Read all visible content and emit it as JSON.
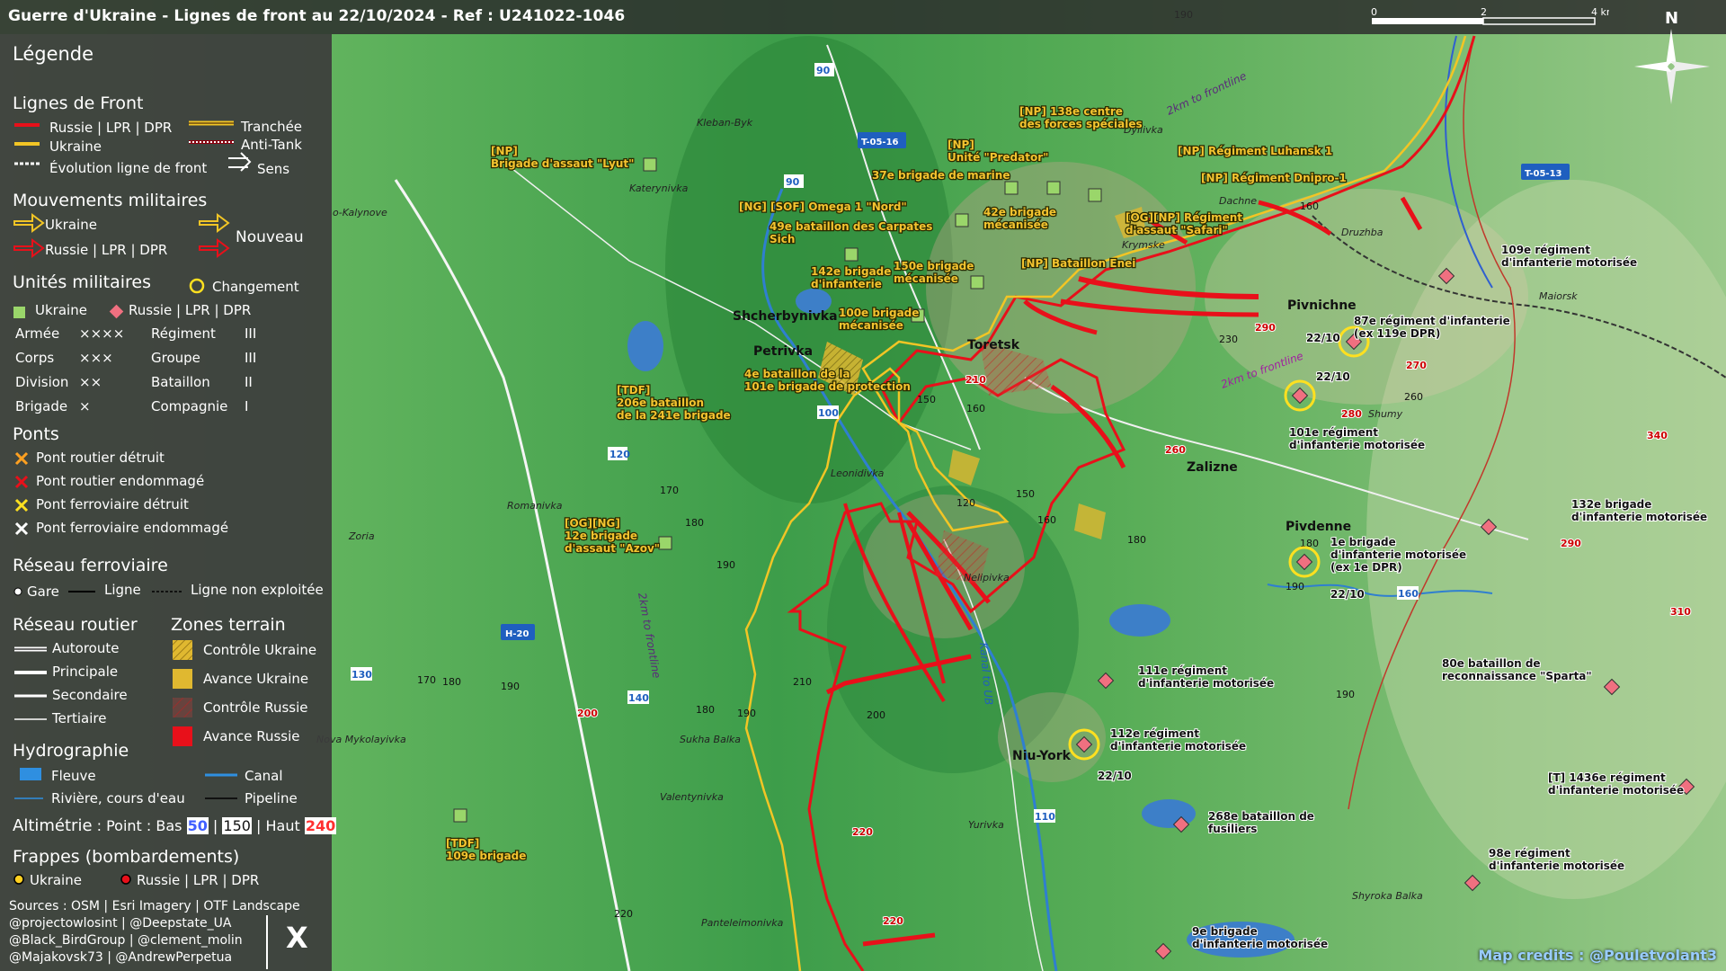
{
  "title": "Guerre d'Ukraine - Lignes de front au 22/10/2024 - Ref : U241022-1046",
  "scale": {
    "ticks": [
      "0",
      "2",
      "4 km"
    ]
  },
  "north": "N",
  "legend": {
    "heading": "Légende",
    "front": {
      "heading": "Lignes de Front",
      "russia": "Russie | LPR | DPR",
      "ukraine": "Ukraine",
      "evolution": "Évolution ligne de front",
      "trench": "Tranchée",
      "antitank": "Anti-Tank",
      "direction": "Sens"
    },
    "movements": {
      "heading": "Mouvements militaires",
      "ukraine": "Ukraine",
      "russia": "Russie | LPR | DPR",
      "new": "Nouveau"
    },
    "units": {
      "heading": "Unités militaires",
      "change": "Changement",
      "ukraine": "Ukraine",
      "russia": "Russie | LPR | DPR",
      "rows": [
        {
          "a": "Armée",
          "as": "××××",
          "b": "Régiment",
          "bs": "III"
        },
        {
          "a": "Corps",
          "as": "×××",
          "b": "Groupe",
          "bs": "III"
        },
        {
          "a": "Division",
          "as": "××",
          "b": "Bataillon",
          "bs": "II"
        },
        {
          "a": "Brigade",
          "as": "×",
          "b": "Compagnie",
          "bs": "I"
        }
      ]
    },
    "bridges": {
      "heading": "Ponts",
      "items": [
        "Pont routier détruit",
        "Pont routier endommagé",
        "Pont ferroviaire détruit",
        "Pont ferroviaire endommagé"
      ]
    },
    "rail": {
      "heading": "Réseau ferroviaire",
      "station": "Gare",
      "line": "Ligne",
      "unused": "Ligne non exploitée"
    },
    "roads": {
      "heading": "Réseau routier",
      "items": [
        "Autoroute",
        "Principale",
        "Secondaire",
        "Tertiaire"
      ]
    },
    "terrain": {
      "heading": "Zones terrain",
      "items": [
        "Contrôle Ukraine",
        "Avance Ukraine",
        "Contrôle Russie",
        "Avance Russie"
      ]
    },
    "hydro": {
      "heading": "Hydrographie",
      "river": "Fleuve",
      "canal": "Canal",
      "stream": "Rivière, cours d'eau",
      "pipeline": "Pipeline"
    },
    "altimetry": {
      "label": "Altimétrie",
      "rest": " : Point : Bas ",
      "low": "50",
      "sep1": " | ",
      "mid": "150",
      "sep2": " | Haut ",
      "high": "240"
    },
    "strikes": {
      "heading": "Frappes (bombardements)",
      "ukraine": "Ukraine",
      "russia": "Russie | LPR | DPR"
    },
    "sources": [
      "Sources : OSM | Esri Imagery | OTF Landscape",
      "@projectowlosint | @Deepstate_UA",
      "@Black_BirdGroup | @clement_molin",
      "@Majakovsk73 | @AndrewPerpetua"
    ],
    "x_logo": "X"
  },
  "credit": "Map credits : @Pouletvolant3",
  "places": {
    "towns": [
      "Toretsk",
      "Shcherbynivka",
      "Petrivka",
      "Pivnichne",
      "Zalizne",
      "Pivdenne",
      "Niu-York"
    ],
    "villages": [
      "Kleban-Byk",
      "Katerynivka",
      "o-Kalynove",
      "Dyliivka",
      "Dachne",
      "Druzhba",
      "Krymske",
      "Maiorsk",
      "Shumy",
      "Leonidivka",
      "Nelipivka",
      "Romanivka",
      "Zoria",
      "Sukha Balka",
      "Valentynivka",
      "Yurivka",
      "Panteleimonivka",
      "Shyroka Balka",
      "Nova Mykolayivka"
    ]
  },
  "road_badges": [
    "T-05-16",
    "T-05-13",
    "H-20"
  ],
  "road_numbers": [
    "90",
    "90",
    "120",
    "100",
    "110",
    "130",
    "140",
    "160"
  ],
  "frontline_notes": [
    "2km to frontline",
    "2km to frontline",
    "2km to frontline",
    "Kanal to UB"
  ],
  "altitudes": {
    "black": [
      "190",
      "150",
      "160",
      "170",
      "180",
      "190",
      "230",
      "260",
      "120",
      "150",
      "160",
      "180",
      "190",
      "210",
      "180",
      "190",
      "200",
      "170",
      "180",
      "190",
      "220",
      "160",
      "180",
      "190"
    ],
    "red": [
      "210",
      "290",
      "270",
      "280",
      "260",
      "340",
      "290",
      "310",
      "200",
      "220",
      "220",
      "290"
    ]
  },
  "units_ukraine": [
    "[NP] 138e centre|des forces spéciales",
    "[NP]|Brigade d'assaut \"Lyut\"",
    "[NP]|Unité \"Predator\"",
    "[NP] Régiment Luhansk 1",
    "37e brigade de marine",
    "[NP] Régiment Dnipro-1",
    "[NG] [SOF] Omega 1 \"Nord\"",
    "42e brigade|mécanisée",
    "[OG][NP] Régiment|d'assaut \"Safari\"",
    "49e bataillon des Carpates|Sich",
    "142e brigade|d'infanterie",
    "150e brigade|mécanisée",
    "[NP] Bataillon Enei",
    "100e brigade|mécanisée",
    "4e bataillon de la|101e brigade de protection",
    "[TDF]|206e bataillon|de la 241e brigade",
    "[OG][NG]|12e brigade|d'assaut \"Azov\"",
    "[TDF]|109e brigade"
  ],
  "units_russia": [
    "109e régiment|d'infanterie motorisée",
    "87e régiment d'infanterie|(ex 119e DPR)",
    "101e régiment|d'infanterie motorisée",
    "132e brigade|d'infanterie motorisée",
    "1e brigade|d'infanterie motorisée|(ex 1e DPR)",
    "80e bataillon de|reconnaissance \"Sparta\"",
    "111e régiment|d'infanterie motorisée",
    "112e régiment|d'infanterie motorisée",
    "[T] 1436e régiment|d'infanterie motorisée",
    "268e bataillon de|fusiliers",
    "98e régiment|d'infanterie motorisée",
    "9e brigade|d'infanterie motorisée"
  ],
  "dates": [
    "22/10",
    "22/10",
    "22/10",
    "22/10"
  ],
  "colors": {
    "russia": "#e8101a",
    "ukraine": "#f2c525",
    "legend_bg": "#3c3c3c",
    "map_green": "#3c9a46"
  }
}
